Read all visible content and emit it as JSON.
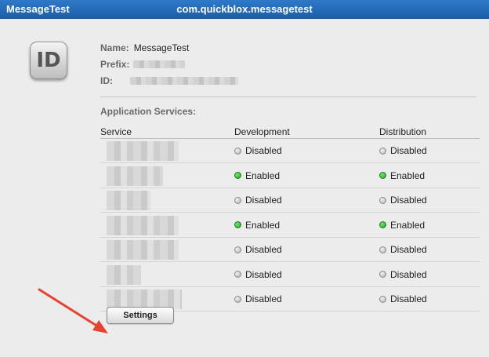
{
  "window": {
    "app_name": "MessageTest",
    "bundle_id": "com.quickblox.messagetest"
  },
  "app_info": {
    "icon_text": "ID",
    "name_label": "Name:",
    "name_value": "MessageTest",
    "prefix_label": "Prefix:",
    "id_label": "ID:"
  },
  "services": {
    "section_title": "Application Services:",
    "columns": [
      "Service",
      "Development",
      "Distribution"
    ],
    "rows": [
      {
        "development": "Disabled",
        "distribution": "Disabled",
        "dev_color": "#a9a9a9",
        "dist_color": "#a9a9a9"
      },
      {
        "development": "Enabled",
        "distribution": "Enabled",
        "dev_color": "#17a517",
        "dist_color": "#17a517"
      },
      {
        "development": "Disabled",
        "distribution": "Disabled",
        "dev_color": "#a9a9a9",
        "dist_color": "#a9a9a9"
      },
      {
        "development": "Enabled",
        "distribution": "Enabled",
        "dev_color": "#17a517",
        "dist_color": "#17a517"
      },
      {
        "development": "Disabled",
        "distribution": "Disabled",
        "dev_color": "#a9a9a9",
        "dist_color": "#a9a9a9"
      },
      {
        "development": "Disabled",
        "distribution": "Disabled",
        "dev_color": "#a9a9a9",
        "dist_color": "#a9a9a9"
      },
      {
        "development": "Disabled",
        "distribution": "Disabled",
        "dev_color": "#a9a9a9",
        "dist_color": "#a9a9a9"
      }
    ]
  },
  "actions": {
    "settings_label": "Settings"
  },
  "colors": {
    "titlebar": "#2f79c8",
    "enabled": "#17a517",
    "disabled": "#a9a9a9",
    "annotation_arrow": "#e8432f"
  }
}
